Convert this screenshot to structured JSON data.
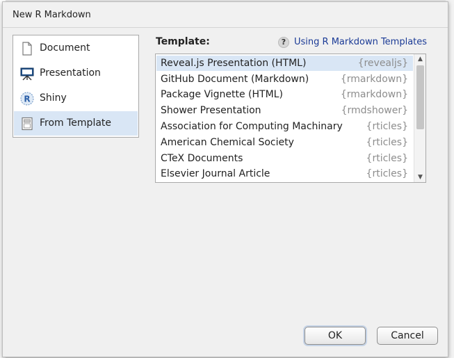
{
  "dialog": {
    "title": "New R Markdown"
  },
  "sidebar": {
    "items": [
      {
        "label": "Document",
        "icon": "document-icon",
        "selected": false
      },
      {
        "label": "Presentation",
        "icon": "presentation-easel-icon",
        "selected": false
      },
      {
        "label": "Shiny",
        "icon": "r-shiny-icon",
        "selected": false
      },
      {
        "label": "From Template",
        "icon": "template-icon",
        "selected": true
      }
    ]
  },
  "template": {
    "heading": "Template:",
    "help_link": "Using R Markdown Templates",
    "items": [
      {
        "name": "Reveal.js Presentation (HTML)",
        "package": "{revealjs}",
        "selected": true
      },
      {
        "name": "GitHub Document (Markdown)",
        "package": "{rmarkdown}",
        "selected": false
      },
      {
        "name": "Package Vignette (HTML)",
        "package": "{rmarkdown}",
        "selected": false
      },
      {
        "name": "Shower Presentation",
        "package": "{rmdshower}",
        "selected": false
      },
      {
        "name": "Association for Computing Machinary",
        "package": "{rticles}",
        "selected": false
      },
      {
        "name": "American Chemical Society",
        "package": "{rticles}",
        "selected": false
      },
      {
        "name": "CTeX Documents",
        "package": "{rticles}",
        "selected": false
      },
      {
        "name": "Elsevier Journal Article",
        "package": "{rticles}",
        "selected": false
      }
    ]
  },
  "buttons": {
    "ok": "OK",
    "cancel": "Cancel"
  },
  "colors": {
    "selection": "#d9e6f5",
    "link": "#1a3a96",
    "package_text": "#8d8d8d"
  }
}
